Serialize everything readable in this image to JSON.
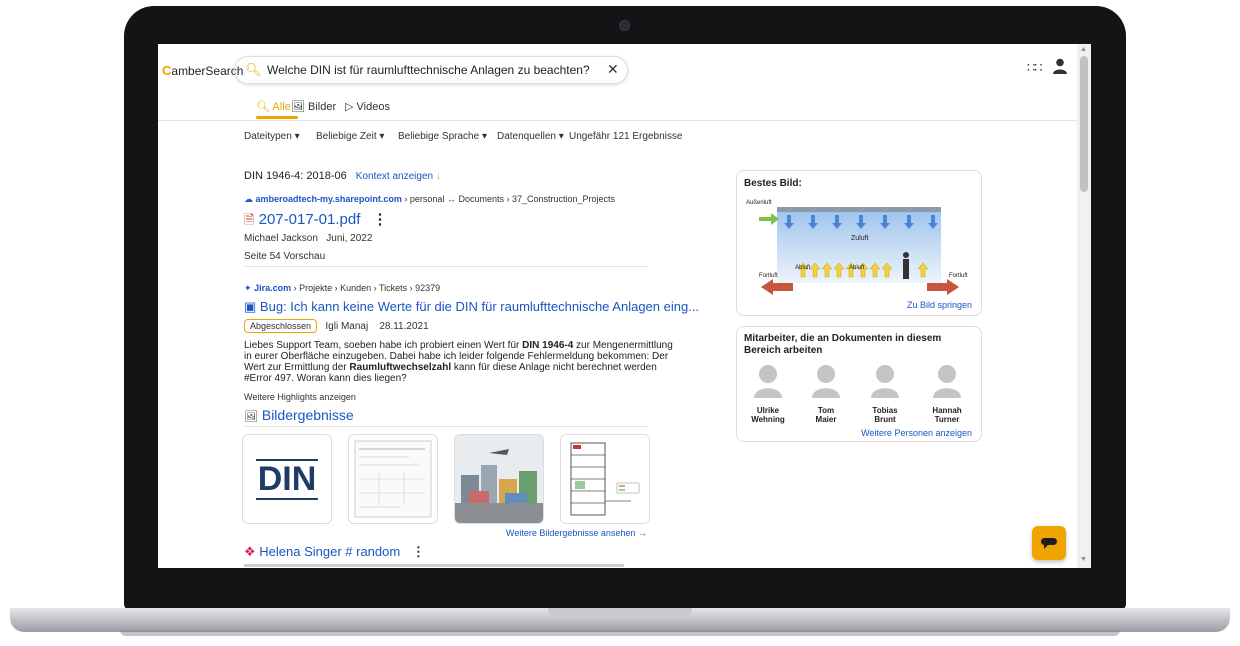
{
  "app": {
    "logo_text": "amberSearch"
  },
  "search": {
    "query": "Welche DIN ist für raumlufttechnische Anlagen zu beachten?"
  },
  "tabs": [
    {
      "label": "Alle",
      "active": true
    },
    {
      "label": "Bilder"
    },
    {
      "label": "Videos"
    }
  ],
  "filters": {
    "items": [
      "Dateitypen",
      "Beliebige Zeit",
      "Beliebige Sprache",
      "Datenquellen"
    ],
    "result_count": "Ungefähr 121 Ergebnisse"
  },
  "result1": {
    "heading": "DIN 1946-4: 2018-06",
    "context_link": "Kontext anzeigen",
    "source_domain": "amberoadtech-my.sharepoint.com",
    "path_personal": "personal",
    "path_rest": "Documents › 37_Construction_Projects",
    "title": "207-017-01.pdf",
    "author": "Michael Jackson",
    "date": "Juni, 2022",
    "preview_link": "Seite 54 Vorschau"
  },
  "result2": {
    "source_domain": "Jira.com",
    "path": "Projekte › Kunden › Tickets › 92379",
    "title": "Bug: Ich kann keine Werte für die DIN für raumlufttechnische Anlagen eing...",
    "status": "Abgeschlossen",
    "author": "Igli Manaj",
    "date": "28.11.2021",
    "snippet_a": "Liebes Support Team, soeben habe ich probiert einen Wert für ",
    "snippet_b": "DIN 1946-4",
    "snippet_c": " zur Mengenermittlung in eurer Oberfläche einzugeben. Dabei habe ich leider folgende Fehlermeldung bekommen: Der Wert zur Ermittlung der ",
    "snippet_d": "Raumluftwechselzahl",
    "snippet_e": " kann für diese Anlage nicht berechnet werden #Error 497. Woran kann dies liegen?",
    "more_link": "Weitere Highlights anzeigen"
  },
  "images_section": {
    "title": "Bildergebnisse",
    "logo_text": "DIN",
    "more_link": "Weitere Bildergebnisse ansehen"
  },
  "result3": {
    "title": "Helena Singer # random"
  },
  "best_image": {
    "title": "Bestes Bild:",
    "label_aussenluft": "Außenluft",
    "label_zuluft": "Zuluft",
    "label_abluft_1": "Abluft",
    "label_abluft_2": "Abluft",
    "label_fortluft_left": "Fortluft",
    "label_fortluft_right": "Fortluft",
    "link": "Zu Bild springen"
  },
  "people": {
    "title": "Mitarbeiter, die an Dokumenten in diesem Bereich arbeiten",
    "list": [
      {
        "first": "Ulrike",
        "last": "Wehning"
      },
      {
        "first": "Tom",
        "last": "Maier"
      },
      {
        "first": "Tobias",
        "last": "Brunt"
      },
      {
        "first": "Hannah",
        "last": "Turner"
      }
    ],
    "more_link": "Weitere Personen anzeigen"
  },
  "colors": {
    "accent": "#f0a400",
    "link": "#1a56c4"
  }
}
